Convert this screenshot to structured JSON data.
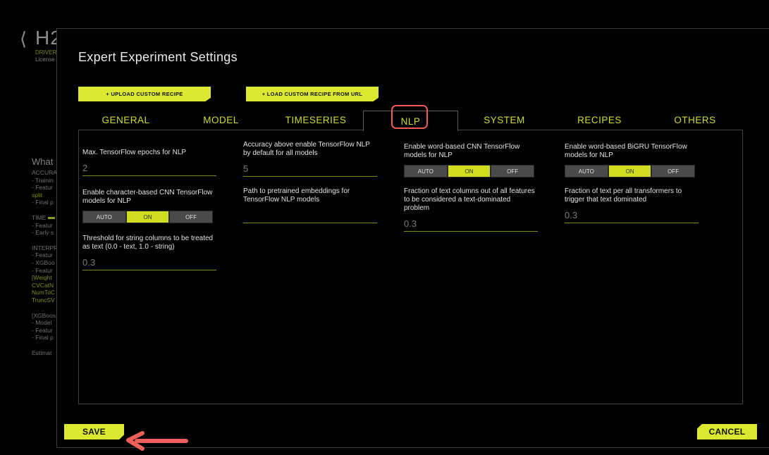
{
  "background": {
    "logo": "H2",
    "subtitle_1": "DRIVER",
    "subtitle_2": "License",
    "lines": [
      {
        "text": "What",
        "cls": "big"
      },
      {
        "text": "ACCURA"
      },
      {
        "text": "- Trainin"
      },
      {
        "text": "- Featur"
      },
      {
        "text": "split",
        "cls": "yl"
      },
      {
        "text": "- Final p"
      },
      {
        "text": "",
        "cls": "gap"
      },
      {
        "text": "TIME",
        "bar": true
      },
      {
        "text": "- Featur"
      },
      {
        "text": "- Early s"
      },
      {
        "text": "",
        "cls": "gap"
      },
      {
        "text": "INTERPR"
      },
      {
        "text": "- Featur"
      },
      {
        "text": "- XGBoo"
      },
      {
        "text": "- Featur"
      },
      {
        "text": "[Weight",
        "cls": "yl"
      },
      {
        "text": "CVCatN",
        "cls": "yl"
      },
      {
        "text": "NumToC",
        "cls": "yl"
      },
      {
        "text": "TruncSV",
        "cls": "yl"
      },
      {
        "text": "",
        "cls": "gap"
      },
      {
        "text": "[XGBoos"
      },
      {
        "text": "- Model"
      },
      {
        "text": "- Featur"
      },
      {
        "text": "- Final p"
      },
      {
        "text": "",
        "cls": "gap"
      },
      {
        "text": "Estimat"
      }
    ]
  },
  "modal": {
    "title": "Expert Experiment Settings",
    "upload_recipe_label": "+ UPLOAD CUSTOM RECIPE",
    "load_recipe_label": "+ LOAD CUSTOM RECIPE FROM URL",
    "tabs": [
      "GENERAL",
      "MODEL",
      "TIMESERIES",
      "NLP",
      "SYSTEM",
      "RECIPES",
      "OTHERS"
    ],
    "active_tab": "NLP",
    "save_label": "SAVE",
    "cancel_label": "CANCEL"
  },
  "nlp_settings": {
    "max_tf_epochs": {
      "label": "Max. TensorFlow epochs for NLP",
      "value": "2"
    },
    "char_cnn": {
      "label": "Enable character-based CNN TensorFlow models for NLP",
      "options": [
        "AUTO",
        "ON",
        "OFF"
      ],
      "selected": "ON"
    },
    "string_threshold": {
      "label": "Threshold for string columns to be treated as text (0.0 - text, 1.0 - string)",
      "value": "0.3"
    },
    "accuracy_threshold": {
      "label": "Accuracy above enable TensorFlow NLP by default for all models",
      "value": "5"
    },
    "pretrained_path": {
      "label": "Path to pretrained embeddings for TensorFlow NLP models",
      "value": ""
    },
    "word_cnn": {
      "label": "Enable word-based CNN TensorFlow models for NLP",
      "options": [
        "AUTO",
        "ON",
        "OFF"
      ],
      "selected": "ON"
    },
    "text_fraction": {
      "label": "Fraction of text columns out of all features to be considered a text-dominated problem",
      "value": "0.3"
    },
    "word_bigru": {
      "label": "Enable word-based BiGRU TensorFlow models for NLP",
      "options": [
        "AUTO",
        "ON",
        "OFF"
      ],
      "selected": "ON"
    },
    "text_transformer_fraction": {
      "label": "Fraction of text per all transformers to trigger that text dominated",
      "value": "0.3"
    }
  },
  "colors": {
    "accent": "#dbe830",
    "highlight": "#ee5a55",
    "arrow": "#f0605a"
  }
}
